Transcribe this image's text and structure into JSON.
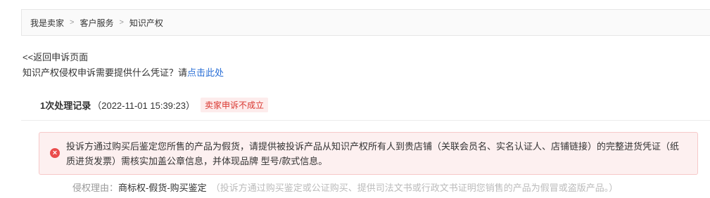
{
  "breadcrumb": {
    "items": [
      "我是卖家",
      "客户服务",
      "知识产权"
    ],
    "separator": ">"
  },
  "back_link": "<<返回申诉页面",
  "faq": {
    "text": "知识产权侵权申诉需要提供什么凭证？请",
    "link": "点击此处"
  },
  "record": {
    "title": "1次处理记录",
    "time": "（2022-11-01 15:39:23）",
    "status": "卖家申诉不成立"
  },
  "alert": {
    "icon": "error-icon",
    "text": "投诉方通过购买后鉴定您所售的产品为假货，请提供被投诉产品从知识产权所有人到贵店铺（关联会员名、实名认证人、店铺链接）的完整进货凭证（纸质进货发票）需核实加盖公章信息，并体现品牌 型号/款式信息。"
  },
  "reason": {
    "label": "侵权理由：",
    "value": "商标权-假货-购买鉴定",
    "note": "（投诉方通过购买鉴定或公证购买、提供司法文书或行政文书证明您销售的产品为假冒或盗版产品。）"
  },
  "colors": {
    "link": "#2a6fd6",
    "error": "#d9362f",
    "alert_bg": "#fdf0f0"
  }
}
